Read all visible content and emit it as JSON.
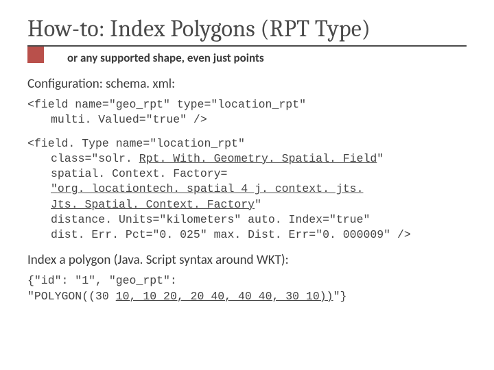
{
  "title": "How-to: Index Polygons (RPT Type)",
  "subtitle": "or any supported shape, even just points",
  "section1": "Configuration: schema. xml:",
  "code1_l1": "<field name=\"geo_rpt\" type=\"location_rpt\"",
  "code1_l2": "multi. Valued=\"true\" />",
  "code2_l1": "<field. Type name=\"location_rpt\"",
  "code2_l2a": "class=\"solr. ",
  "code2_l2u": "Rpt. With. Geometry. Spatial. Field",
  "code2_l2b": "\"",
  "code2_l3": "spatial. Context. Factory=",
  "code2_l4a": "\"",
  "code2_l4u": "org. locationtech. spatial 4 j. context. jts.",
  "code2_l5u": "Jts. Spatial. Context. Factory",
  "code2_l5b": "\"",
  "code2_l6": "distance. Units=\"kilometers\" auto. Index=\"true\"",
  "code2_l7": "dist. Err. Pct=\"0. 025\" max. Dist. Err=\"0. 000009\" />",
  "section2": "Index a polygon (Java. Script syntax around WKT):",
  "code3_l1": "{\"id\": \"1\", \"geo_rpt\":",
  "code3_l2a": "\"POLYGON((30 ",
  "code3_l2u": "10, 10 20, 20 40, 40 40, 30 10))",
  "code3_l2b": "\"}"
}
